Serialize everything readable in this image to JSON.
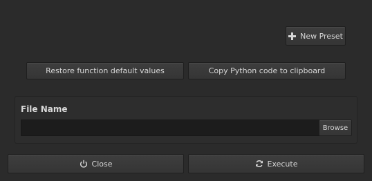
{
  "presets": {
    "new_preset_label": "New Preset",
    "new_preset_icon": "plus-icon"
  },
  "actions": {
    "restore_defaults_label": "Restore function default values",
    "copy_python_label": "Copy Python code to clipboard"
  },
  "file_group": {
    "title": "File Name",
    "value": "",
    "browse_label": "Browse"
  },
  "footer": {
    "close_label": "Close",
    "close_icon": "power-icon",
    "execute_label": "Execute",
    "execute_icon": "refresh-icon"
  }
}
